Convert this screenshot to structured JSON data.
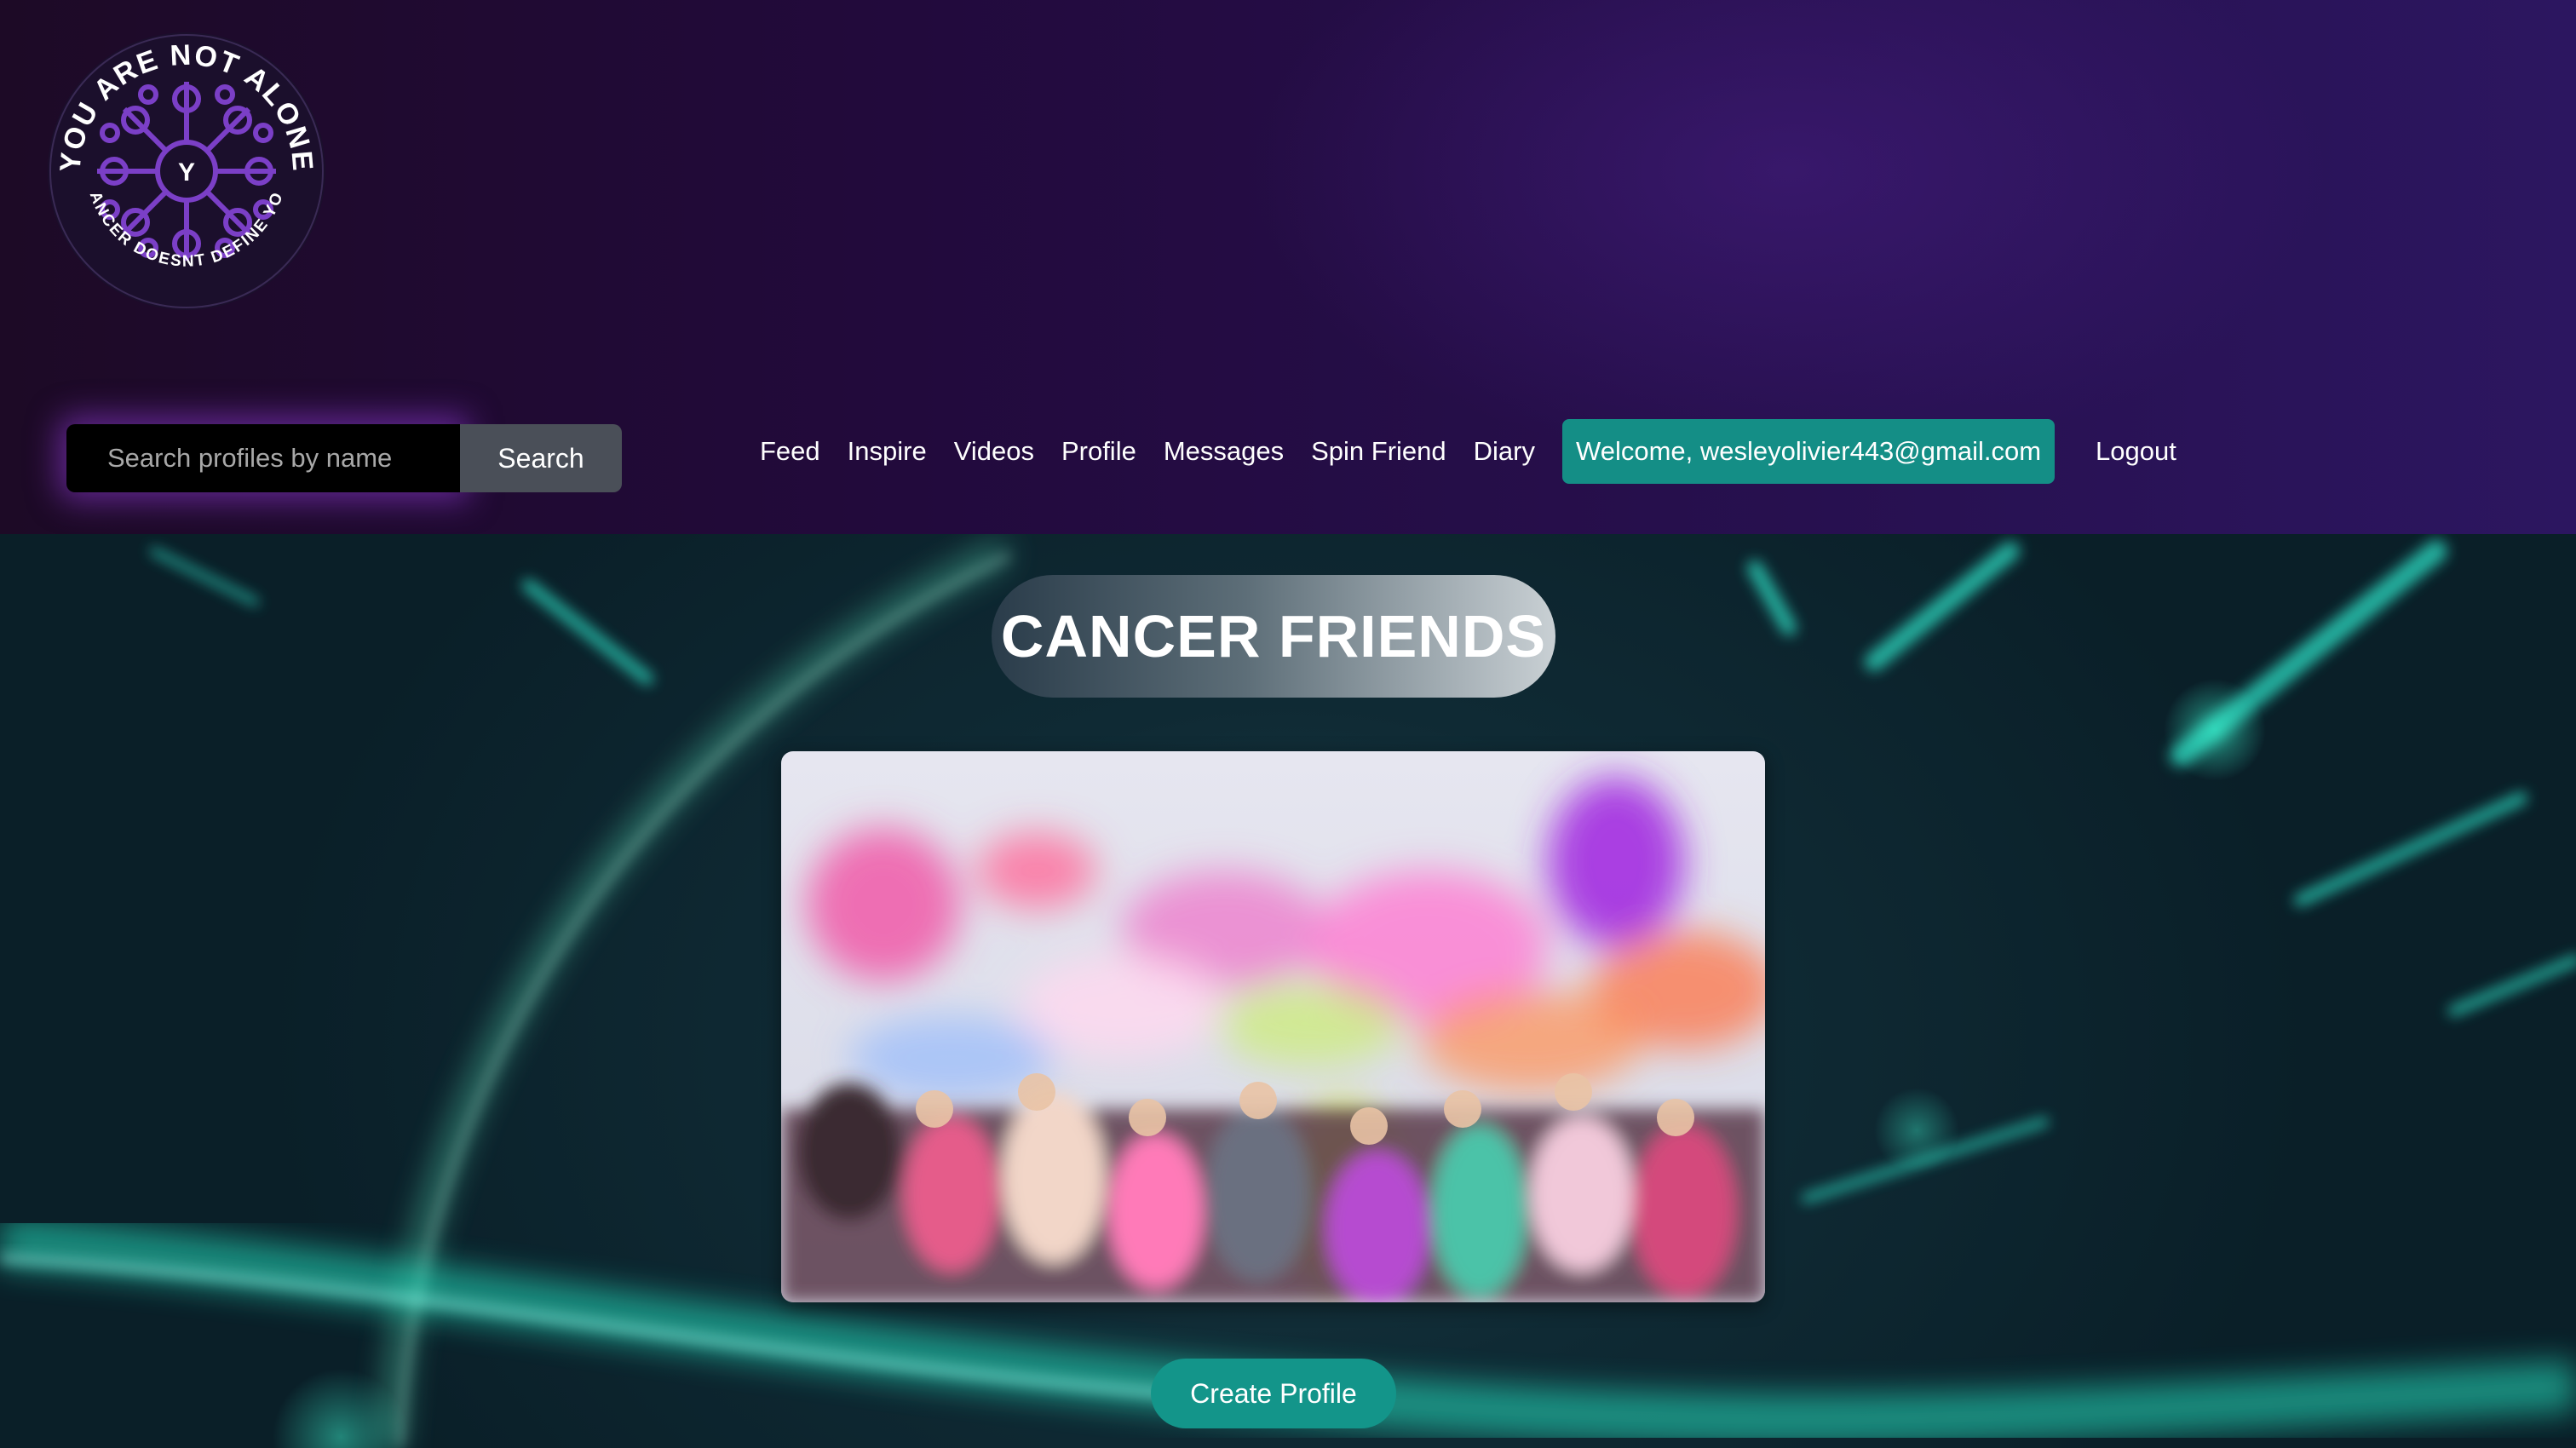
{
  "logo": {
    "top_text": "YOU ARE NOT ALONE",
    "bottom_text": "CANCER DOESNT DEFINE YOU",
    "center_letter": "Y"
  },
  "search": {
    "placeholder": "Search profiles by name",
    "value": "",
    "button_label": "Search"
  },
  "nav": {
    "items": [
      {
        "label": "Feed"
      },
      {
        "label": "Inspire"
      },
      {
        "label": "Videos"
      },
      {
        "label": "Profile"
      },
      {
        "label": "Messages"
      },
      {
        "label": "Spin Friend"
      },
      {
        "label": "Diary"
      }
    ],
    "welcome": "Welcome, wesleyolivier443@gmail.com",
    "logout": "Logout"
  },
  "main": {
    "title": "CANCER FRIENDS",
    "create_button": "Create Profile"
  },
  "colors": {
    "accent_teal": "#148e86",
    "header_purple": "#220a3c",
    "glow_purple": "#963cdc"
  }
}
